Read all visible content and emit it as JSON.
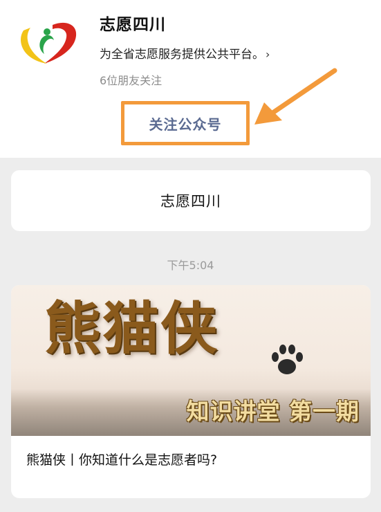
{
  "account": {
    "name": "志愿四川",
    "description": "为全省志愿服务提供公共平台。",
    "friends_following": "6位朋友关注",
    "follow_button_label": "关注公众号"
  },
  "feed": {
    "name_card_text": "志愿四川",
    "timestamp": "下午5:04",
    "article": {
      "cover_title": "熊猫侠",
      "cover_subtitle": "知识讲堂 第一期",
      "title": "熊猫侠丨你知道什么是志愿者吗?"
    }
  },
  "icons": {
    "chevron": "chevron-right-icon",
    "logo": "heart-logo-icon",
    "arrow": "pointer-arrow-icon",
    "paw": "paw-icon"
  },
  "colors": {
    "highlight": "#f39a3b",
    "follow_text": "#5a6a91",
    "feed_background": "#ededed",
    "logo_red": "#d7261e",
    "logo_yellow": "#f2c318",
    "logo_green": "#2aa44a"
  }
}
